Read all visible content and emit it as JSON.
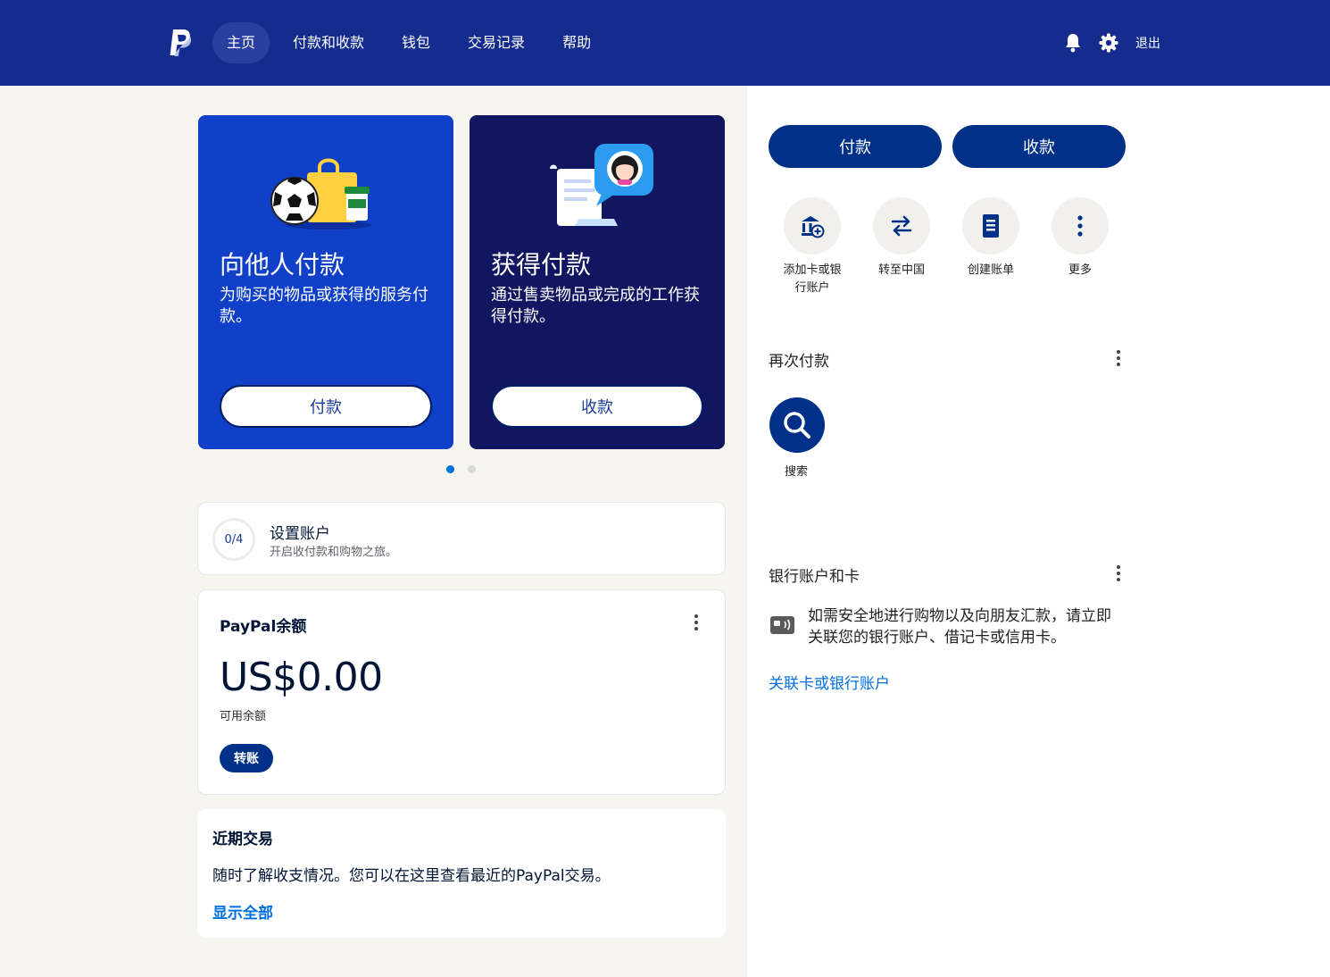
{
  "colors": {
    "header_bg": "#142c8e",
    "primary_button": "#003087",
    "link": "#0070e0",
    "pay_card": "#1040c8",
    "receive_card": "#121661"
  },
  "header": {
    "logo": "paypal-logo-icon",
    "nav": [
      {
        "label": "主页",
        "active": true
      },
      {
        "label": "付款和收款"
      },
      {
        "label": "钱包"
      },
      {
        "label": "交易记录"
      },
      {
        "label": "帮助"
      }
    ],
    "icons": [
      "bell-icon",
      "gear-icon"
    ],
    "logout_label": "退出"
  },
  "cards": {
    "pay": {
      "title": "向他人付款",
      "description": "为购买的物品或获得的服务付款。",
      "button": "付款"
    },
    "receive": {
      "title": "获得付款",
      "description": "通过售卖物品或完成的工作获得付款。",
      "button": "收款"
    }
  },
  "carousel": {
    "pages": 2,
    "active_index": 0
  },
  "setup": {
    "progress": "0/4",
    "title": "设置账户",
    "subtitle": "开启收付款和购物之旅。"
  },
  "balance": {
    "title": "PayPal余额",
    "amount": "US$0.00",
    "subtitle": "可用余额",
    "button": "转账"
  },
  "recent": {
    "title": "近期交易",
    "description": "随时了解收支情况。您可以在这里查看最近的PayPal交易。",
    "link": "显示全部"
  },
  "actions": {
    "pay": "付款",
    "receive": "收款"
  },
  "quick_actions": [
    {
      "label": "添加卡或银行账户",
      "icon": "bank-add-icon"
    },
    {
      "label": "转至中国",
      "icon": "transfer-arrows-icon"
    },
    {
      "label": "创建账单",
      "icon": "invoice-icon"
    },
    {
      "label": "更多",
      "icon": "more-vertical-icon"
    }
  ],
  "pay_again": {
    "title": "再次付款",
    "search_label": "搜索"
  },
  "bank": {
    "title": "银行账户和卡",
    "description": "如需安全地进行购物以及向朋友汇款，请立即关联您的银行账户、借记卡或信用卡。",
    "link": "关联卡或银行账户"
  }
}
